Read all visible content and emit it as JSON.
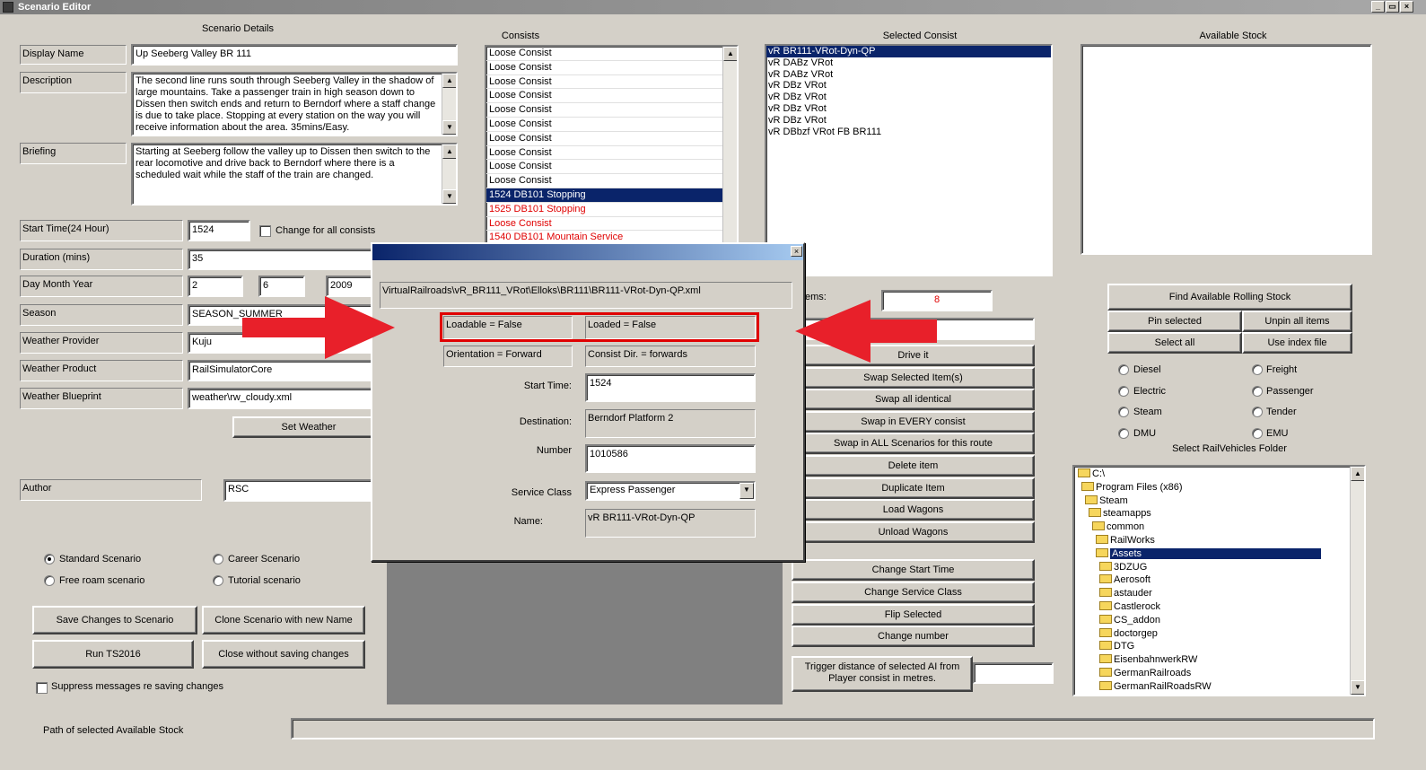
{
  "window": {
    "title": "Scenario Editor",
    "min_label": "_",
    "restore_label": "▭",
    "close_label": "×"
  },
  "details": {
    "heading": "Scenario Details",
    "display_name_label": "Display Name",
    "display_name": "Up Seeberg Valley BR 111",
    "description_label": "Description",
    "description": "The second line runs south through Seeberg Valley in the shadow of large mountains.  Take a passenger train in high season down to Dissen then switch ends and return to Berndorf where a staff change is due to take place. Stopping at every station on the way you will receive information about the area. 35mins/Easy.",
    "briefing_label": "Briefing",
    "briefing": "Starting at Seeberg follow the valley up to Dissen then switch to the rear locomotive and drive back to Berndorf where there is a scheduled wait while the staff of the train are changed.",
    "start_time_label": "Start Time(24 Hour)",
    "start_time": "1524",
    "change_all_label": "Change for all consists",
    "duration_label": "Duration (mins)",
    "duration": "35",
    "dmy_label": "Day Month Year",
    "day": "2",
    "month": "6",
    "year": "2009",
    "season_label": "Season",
    "season": "SEASON_SUMMER",
    "weather_provider_label": "Weather Provider",
    "weather_provider": "Kuju",
    "weather_product_label": "Weather Product",
    "weather_product": "RailSimulatorCore",
    "weather_blueprint_label": "Weather Blueprint",
    "weather_blueprint": "weather\\rw_cloudy.xml",
    "set_weather": "Set Weather",
    "author_label": "Author",
    "author": "RSC",
    "standard": "Standard Scenario",
    "career": "Career Scenario",
    "freeroam": "Free roam scenario",
    "tutorial": "Tutorial scenario",
    "save_btn": "Save Changes to Scenario",
    "clone_btn": "Clone Scenario with new Name",
    "run_btn": "Run TS2016",
    "close_btn": "Close without saving changes",
    "suppress": "Suppress messages re saving changes",
    "path_label": "Path of selected Available Stock",
    "path_value": ""
  },
  "consists": {
    "heading": "Consists",
    "items": [
      "Loose Consist",
      "Loose Consist",
      "Loose Consist",
      "Loose Consist",
      "Loose Consist",
      "Loose Consist",
      "Loose Consist",
      "Loose Consist",
      "Loose Consist",
      "Loose Consist",
      "1524 DB101 Stopping",
      "1525 DB101 Stopping",
      "Loose Consist",
      "1540 DB101 Mountain Service"
    ],
    "up_arrow": "▲"
  },
  "selected_consist": {
    "heading": "Selected Consist",
    "items": [
      "vR BR111-VRot-Dyn-QP",
      "vR DABz VRot",
      "vR DABz VRot",
      "vR DBz VRot",
      "vR DBz VRot",
      "vR DBz VRot",
      "vR DBz VRot",
      "vR DBbzf VRot FB BR111"
    ],
    "items_label": "ems:",
    "items_count": "8",
    "actions": [
      "Drive it",
      "Swap Selected Item(s)",
      "Swap all identical",
      "Swap in EVERY consist",
      "Swap in ALL Scenarios for this route",
      "Delete item",
      "Duplicate Item",
      "Load Wagons",
      "Unload Wagons"
    ],
    "actions2": [
      "Change Start Time",
      "Change Service Class",
      "Flip Selected",
      "Change number"
    ],
    "trigger_label": "Trigger distance of selected AI from Player consist in metres.",
    "trigger_value": ""
  },
  "stock": {
    "heading": "Available Stock",
    "find_btn": "Find Available Rolling Stock",
    "pin_btn": "Pin selected",
    "unpin_btn": "Unpin all items",
    "selectall_btn": "Select all",
    "index_btn": "Use index file",
    "types_left": [
      "Diesel",
      "Electric",
      "Steam",
      "DMU"
    ],
    "types_right": [
      "Freight",
      "Passenger",
      "Tender",
      "EMU"
    ],
    "folder_heading": "Select RailVehicles Folder",
    "tree": [
      "C:\\",
      "Program Files (x86)",
      "Steam",
      "steamapps",
      "common",
      "RailWorks",
      "Assets",
      "3DZUG",
      "Aerosoft",
      "astauder",
      "Castlerock",
      "CS_addon",
      "doctorgep",
      "DTG",
      "EisenbahnwerkRW",
      "GermanRailroads",
      "GermanRailRoadsRW"
    ],
    "up_arrow": "▲",
    "down_arrow": "▼"
  },
  "dialog": {
    "close_label": "×",
    "path": "VirtualRailroads\\vR_BR111_VRot\\Elloks\\BR111\\BR111-VRot-Dyn-QP.xml",
    "loadable": "Loadable = False",
    "loaded": "Loaded = False",
    "orientation": "Orientation = Forward",
    "consist_dir": "Consist Dir. = forwards",
    "start_time_label": "Start Time:",
    "start_time": "1524",
    "destination_label": "Destination:",
    "destination": "Berndorf Platform 2",
    "number_label": "Number",
    "number": "1010586",
    "service_class_label": "Service Class",
    "service_class": "Express Passenger",
    "dropdown_arrow": "▼",
    "name_label": "Name:",
    "name": "vR BR111-VRot-Dyn-QP"
  },
  "colors": {
    "selection": "#0a246a",
    "annotation_red": "#e8202a",
    "warning_red": "#e00000"
  }
}
